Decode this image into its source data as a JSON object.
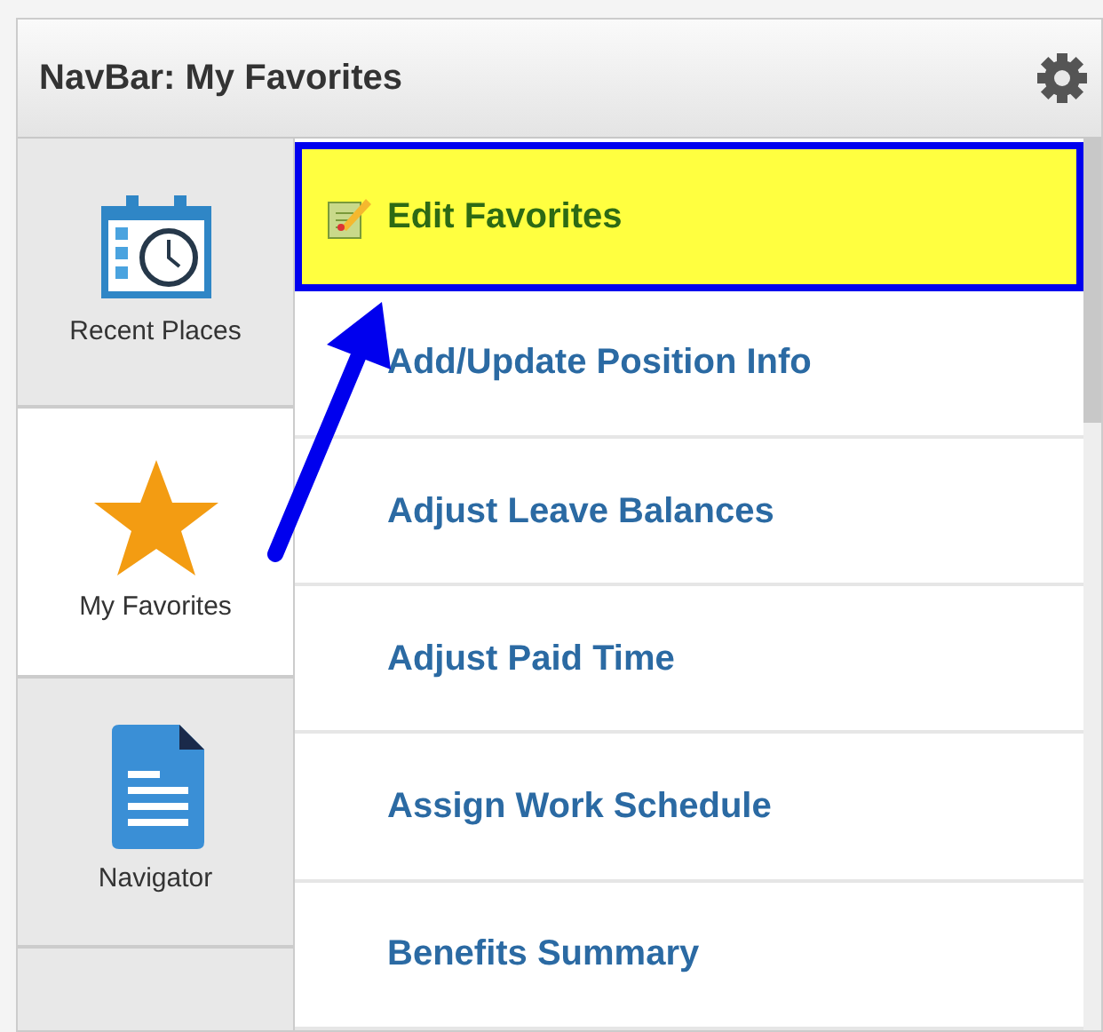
{
  "panel": {
    "title": "NavBar: My Favorites"
  },
  "tabs": [
    {
      "label": "Recent Places",
      "kind": "calendar",
      "selected": false
    },
    {
      "label": "My Favorites",
      "kind": "star",
      "selected": true
    },
    {
      "label": "Navigator",
      "kind": "document",
      "selected": false
    }
  ],
  "items": [
    {
      "label": "Edit Favorites",
      "kind": "edit",
      "highlighted": true
    },
    {
      "label": "Add/Update Position Info",
      "kind": "link",
      "highlighted": false
    },
    {
      "label": "Adjust Leave Balances",
      "kind": "link",
      "highlighted": false
    },
    {
      "label": "Adjust Paid Time",
      "kind": "link",
      "highlighted": false
    },
    {
      "label": "Assign Work Schedule",
      "kind": "link",
      "highlighted": false
    },
    {
      "label": "Benefits Summary",
      "kind": "link",
      "highlighted": false
    }
  ]
}
